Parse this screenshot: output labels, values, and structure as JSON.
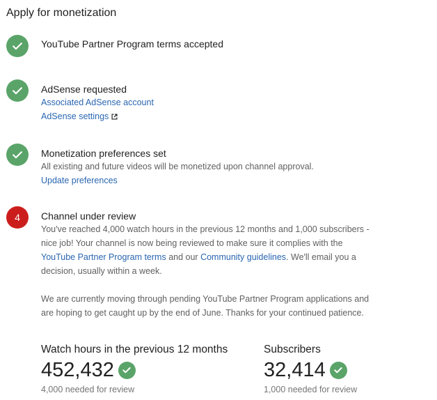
{
  "page": {
    "title": "Apply for monetization"
  },
  "steps": [
    {
      "status": "done",
      "title": "YouTube Partner Program terms accepted"
    },
    {
      "status": "done",
      "title": "AdSense requested",
      "links": [
        "Associated AdSense account",
        "AdSense settings"
      ]
    },
    {
      "status": "done",
      "title": "Monetization preferences set",
      "description": "All existing and future videos will be monetized upon channel approval.",
      "link": "Update preferences"
    },
    {
      "status": "pending",
      "number": "4",
      "title": "Channel under review",
      "para1_a": "You've reached 4,000 watch hours in the previous 12 months and 1,000 subscribers - nice job! Your channel is now being reviewed to make sure it complies with the ",
      "terms_link": "YouTube Partner Program terms",
      "para1_b": " and our ",
      "guidelines_link": "Community guidelines",
      "para1_c": ". We'll email you a decision, usually within a week.",
      "para2": "We are currently moving through pending YouTube Partner Program applications and are hoping to get caught up by the end of June. Thanks for your continued patience."
    }
  ],
  "stats": {
    "watch_hours": {
      "label": "Watch hours in the previous 12 months",
      "value": "452,432",
      "note": "4,000 needed for review"
    },
    "subscribers": {
      "label": "Subscribers",
      "value": "32,414",
      "note": "1,000 needed for review"
    }
  },
  "colors": {
    "success": "#5aa469",
    "pending": "#cc1d1d",
    "link": "#2a66b1"
  },
  "icons": {
    "done": "check-icon",
    "external": "external-link-icon"
  }
}
